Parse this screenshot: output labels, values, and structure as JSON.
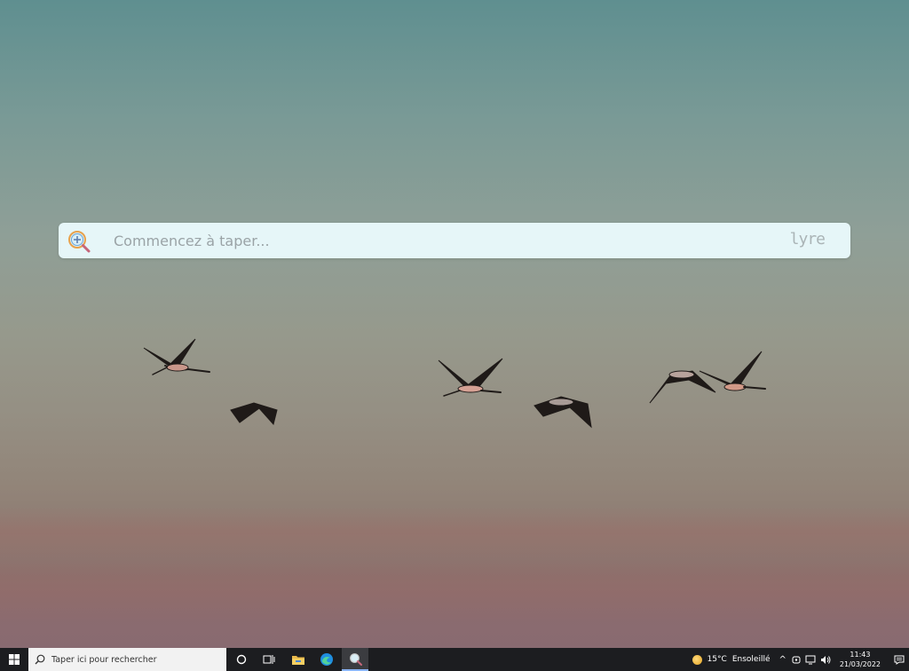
{
  "search": {
    "placeholder": "Commencez à taper...",
    "brand": "lyre",
    "icon": "magnifier-plus-icon"
  },
  "taskbar": {
    "search_placeholder": "Taper ici pour rechercher",
    "apps": [
      {
        "name": "cortana-icon"
      },
      {
        "name": "task-view-icon"
      },
      {
        "name": "file-explorer-icon"
      },
      {
        "name": "edge-icon"
      },
      {
        "name": "search-app-icon"
      }
    ],
    "weather": {
      "temperature": "15°C",
      "condition": "Ensoleillé"
    },
    "clock": {
      "time": "11:43",
      "date": "21/03/2022"
    }
  }
}
